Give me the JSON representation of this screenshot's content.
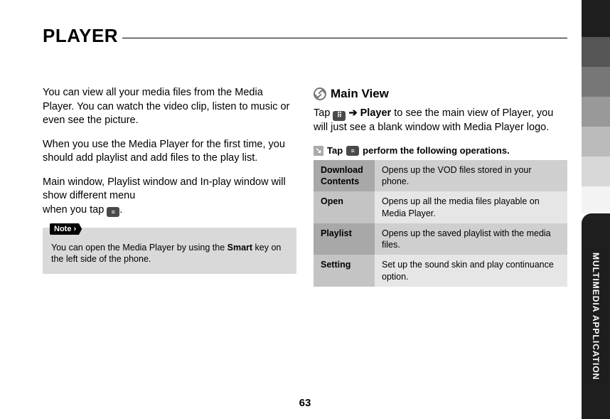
{
  "title": "PLAYER",
  "left": {
    "p1": "You can view all your media files from the Media Player. You can watch the video clip, listen to music or even see the picture.",
    "p2": "When you use the Media Player for the first time, you should add playlist and add files to the play list.",
    "p3a": "Main window, Playlist window and In-play window will show different menu",
    "p3b": "when you tap ",
    "p3c": ".",
    "note_label": "Note ›",
    "note_text_a": "You can open the Media Player by using the ",
    "note_bold": "Smart",
    "note_text_b": " key on the left side of the phone."
  },
  "right": {
    "section_title": "Main View",
    "intro_a": "Tap ",
    "intro_arrow": " ➔ ",
    "intro_bold": "Player",
    "intro_b": " to see the main view of Player, you will just see a blank window with Media Player logo.",
    "tip_a": "Tap ",
    "tip_b": " perform the following operations.",
    "table": [
      {
        "k": "Download Contents",
        "v": "Opens up the VOD files stored in your phone."
      },
      {
        "k": "Open",
        "v": "Opens up all the media files playable on Media Player."
      },
      {
        "k": "Playlist",
        "v": "Opens up the saved playlist with the media files."
      },
      {
        "k": "Setting",
        "v": "Set up the sound skin and play continuance option."
      }
    ]
  },
  "side_label": "MULTIMEDIA APPLICATION",
  "page_number": "63"
}
